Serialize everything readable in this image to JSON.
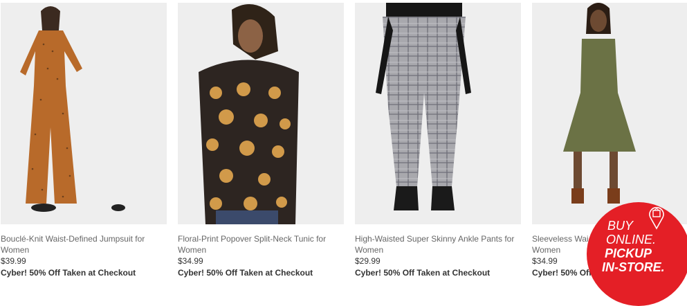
{
  "products": [
    {
      "title": "Bouclé-Knit Waist-Defined Jumpsuit for Women",
      "price": "$39.99",
      "promo": "Cyber! 50% Off Taken at Checkout",
      "image_alt": "model-wearing-rust-polka-dot-jumpsuit"
    },
    {
      "title": "Floral-Print Popover Split-Neck Tunic for Women",
      "price": "$34.99",
      "promo": "Cyber! 50% Off Taken at Checkout",
      "image_alt": "model-wearing-floral-tunic"
    },
    {
      "title": "High-Waisted Super Skinny Ankle Pants for Women",
      "price": "$29.99",
      "promo": "Cyber! 50% Off Taken at Checkout",
      "image_alt": "model-wearing-plaid-ankle-pants"
    },
    {
      "title": "Sleeveless Wai",
      "title_line2": "Women",
      "price": "$34.99",
      "promo": "Cyber! 50% Off T",
      "image_alt": "model-wearing-olive-sleeveless-dress"
    }
  ],
  "badge": {
    "line1": "BUY",
    "line2": "ONLINE.",
    "line3": "PICKUP",
    "line4": "IN-STORE.",
    "color": "#e41f26",
    "icon": "shopping-bag-pin-icon"
  }
}
